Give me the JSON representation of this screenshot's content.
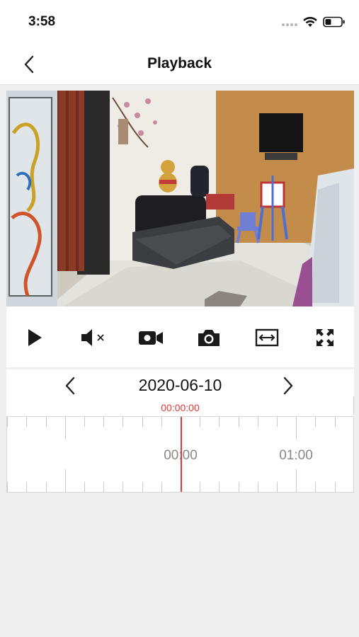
{
  "status_bar": {
    "time": "3:58",
    "icons": [
      "signal-dots-icon",
      "wifi-icon",
      "battery-icon"
    ]
  },
  "nav": {
    "title": "Playback",
    "back_icon": "chevron-left-icon"
  },
  "controls": [
    {
      "name": "play-button",
      "icon": "play-icon"
    },
    {
      "name": "mute-button",
      "icon": "speaker-muted-icon"
    },
    {
      "name": "record-button",
      "icon": "video-camera-icon"
    },
    {
      "name": "snapshot-button",
      "icon": "camera-icon"
    },
    {
      "name": "fit-width-button",
      "icon": "fit-width-icon"
    },
    {
      "name": "fullscreen-button",
      "icon": "fullscreen-icon"
    }
  ],
  "date_nav": {
    "date": "2020-06-10",
    "current_time": "00:00:00",
    "prev_icon": "chevron-left-icon",
    "next_icon": "chevron-right-icon"
  },
  "timeline": {
    "labels": [
      "00:00",
      "01:00"
    ]
  },
  "colors": {
    "accent_red": "#e53935",
    "background": "#efefef",
    "card": "#ffffff"
  }
}
